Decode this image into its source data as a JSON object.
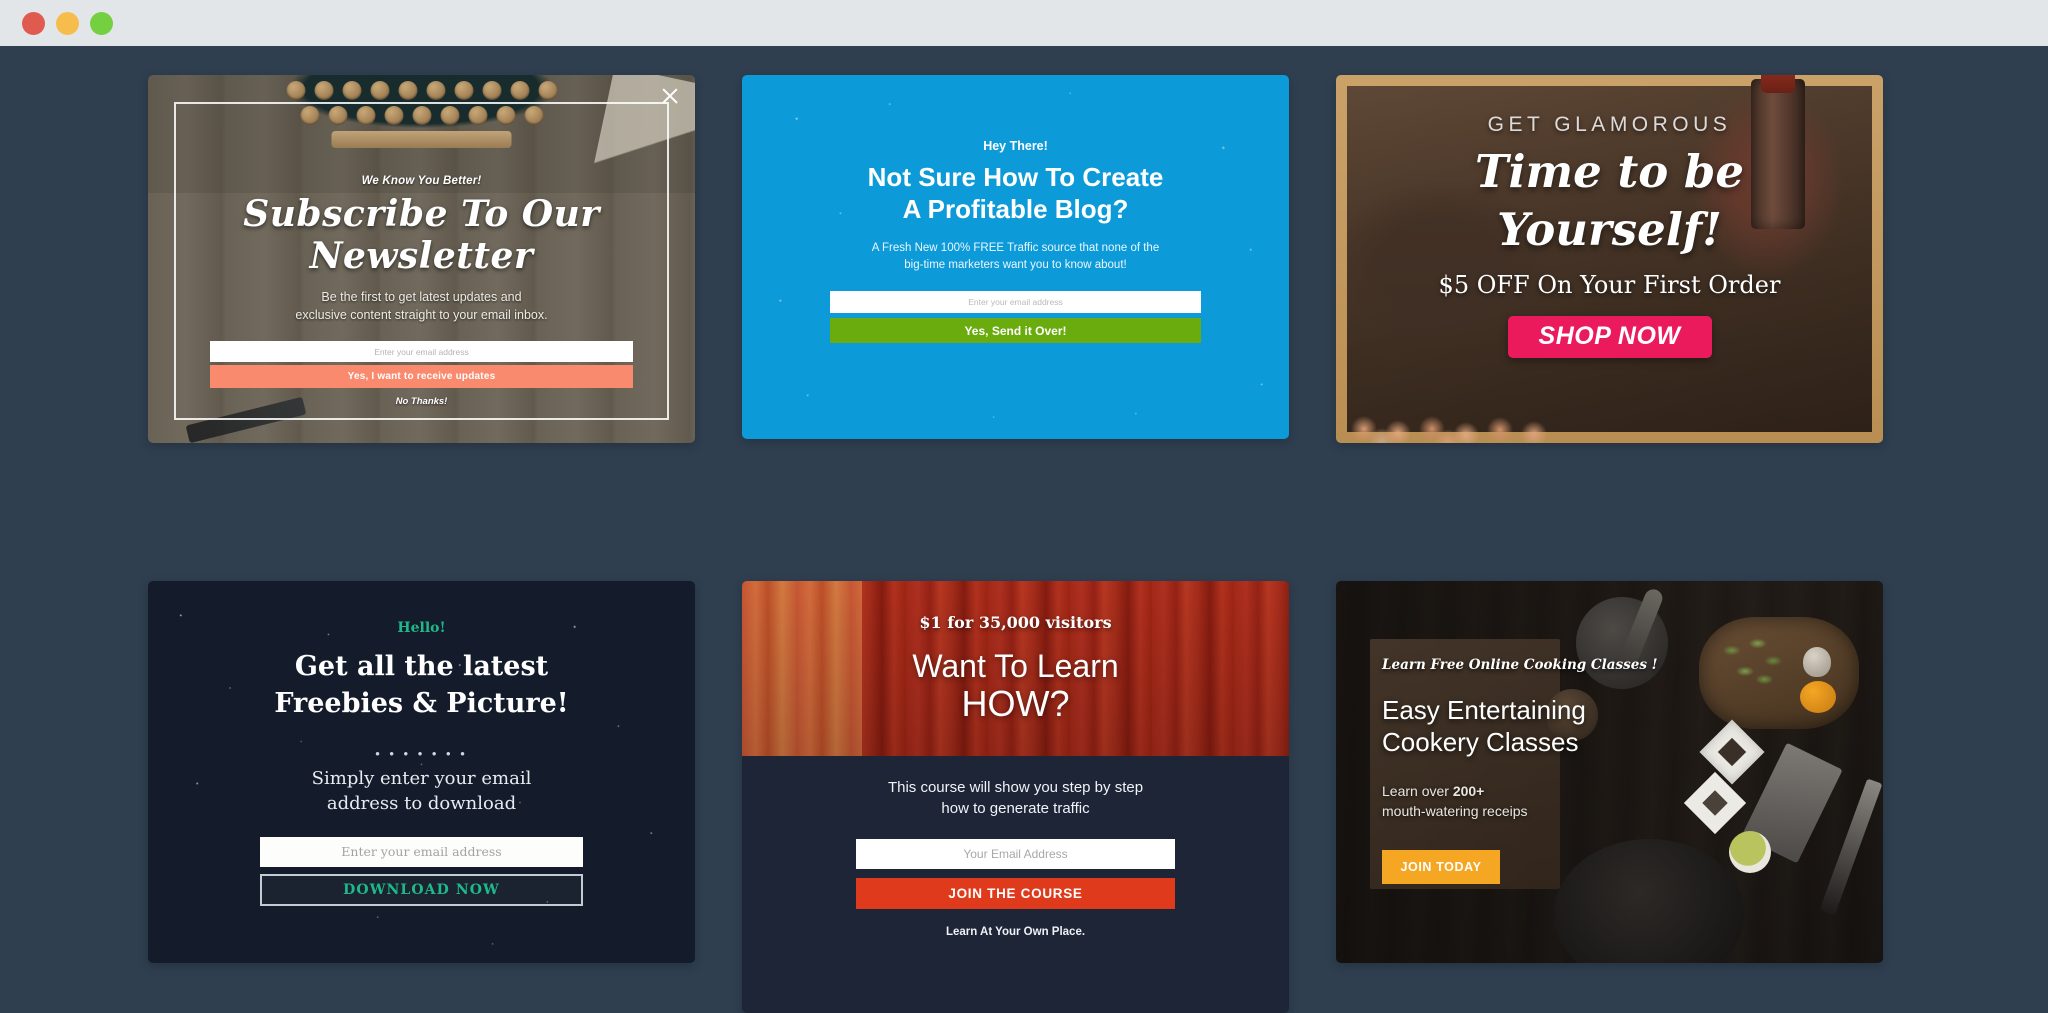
{
  "window": {
    "traffic_lights": [
      {
        "name": "close",
        "color": "#e05a4f"
      },
      {
        "name": "minimize",
        "color": "#f6bd4d"
      },
      {
        "name": "maximize",
        "color": "#74cf41"
      }
    ],
    "background_color": "#2f3f50",
    "titlebar_color": "#e3e6e9"
  },
  "cards": [
    {
      "id": "newsletter",
      "eyebrow": "We Know You Better!",
      "title": "Subscribe To Our Newsletter",
      "subtitle": "Be the first to get latest updates and\nexclusive content straight to your email inbox.",
      "subtitle_line1": "Be the first to get latest updates and",
      "subtitle_line2": "exclusive content straight to your email inbox.",
      "input_placeholder": "Enter your email address",
      "button_label": "Yes, I want to receive updates",
      "decline_label": "No Thanks!",
      "close_icon": "close-icon",
      "accent_color": "#fa8a6e"
    },
    {
      "id": "profitable-blog",
      "eyebrow": "Hey There!",
      "title_line1": "Not Sure How To Create",
      "title_line2": "A Profitable Blog?",
      "subtitle_line1": "A Fresh New 100% FREE Traffic source that none of the",
      "subtitle_line2": "big-time marketers want you to know about!",
      "input_placeholder": "Enter your email address",
      "button_label": "Yes, Send it Over!",
      "background_color": "#0d9ad8",
      "accent_color": "#6aab0e"
    },
    {
      "id": "get-glamorous",
      "eyebrow": "GET GLAMOROUS",
      "title_line1": "Time to be",
      "title_line2": "Yourself!",
      "offer": "$5 OFF On Your First Order",
      "button_label": "SHOP NOW",
      "accent_color": "#ea1a5c"
    },
    {
      "id": "freebies",
      "eyebrow": "Hello!",
      "title_line1": "Get all the latest",
      "title_line2": "Freebies & Picture!",
      "divider": "• • • • • • •",
      "subtitle_line1": "Simply enter your email",
      "subtitle_line2": "address to download",
      "input_placeholder": "Enter your email address",
      "button_label": "DOWNLOAD NOW",
      "background_color": "#141c2b",
      "accent_color": "#1eb98a"
    },
    {
      "id": "want-to-learn",
      "price_line": "$1 for 35,000 visitors",
      "title_line1": "Want To Learn",
      "title_line2": "HOW?",
      "subtitle_line1": "This course will show you step by step",
      "subtitle_line2": "how to generate traffic",
      "input_placeholder": "Your Email Address",
      "button_label": "JOIN THE COURSE",
      "footer": "Learn At Your Own Place.",
      "background_color": "#1d2537",
      "accent_color": "#e03a1c"
    },
    {
      "id": "cookery-classes",
      "eyebrow": "Learn Free Online Cooking Classes !",
      "title_line1": "Easy Entertaining",
      "title_line2": "Cookery Classes",
      "subtitle_line1": "Learn over 200+",
      "subtitle_line1_plain": "Learn over ",
      "subtitle_highlight": "200+",
      "subtitle_line2": "mouth-watering receips",
      "button_label": "JOIN TODAY",
      "accent_color": "#f5a623"
    }
  ]
}
